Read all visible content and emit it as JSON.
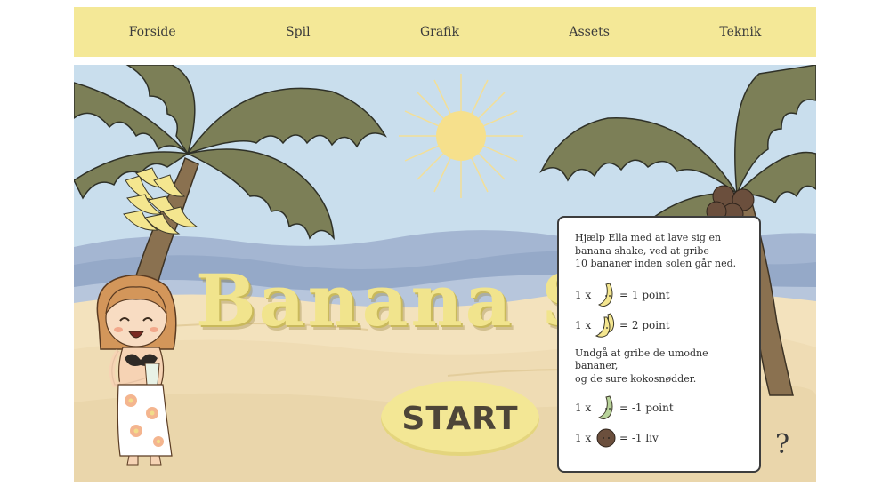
{
  "nav": {
    "items": [
      {
        "label": "Forside"
      },
      {
        "label": "Spil"
      },
      {
        "label": "Grafik"
      },
      {
        "label": "Assets"
      },
      {
        "label": "Teknik"
      }
    ]
  },
  "game": {
    "title": "Banana S",
    "start_label": "START",
    "help_label": "?"
  },
  "instructions": {
    "intro_lines": [
      "Hjælp Ella med at lave sig en",
      "banana shake, ved at gribe",
      "10 bananer inden solen går ned."
    ],
    "good_items": [
      {
        "qty": "1 x",
        "icon": "single-banana-icon",
        "value": "= 1 point"
      },
      {
        "qty": "1 x",
        "icon": "banana-bunch-icon",
        "value": "= 2 point"
      }
    ],
    "avoid_lines": [
      "Undgå at gribe de umodne bananer,",
      "og de sure kokosnødder."
    ],
    "bad_items": [
      {
        "qty": "1 x",
        "icon": "green-banana-icon",
        "value": "= -1 point"
      },
      {
        "qty": "1 x",
        "icon": "coconut-icon",
        "value": "= -1 liv"
      }
    ]
  },
  "colors": {
    "nav_background": "#f4e897",
    "sky": "#c9deed",
    "sea": "#9fb3cf",
    "sand": "#f3e2bd",
    "palm_leaf": "#7c7f57",
    "palm_trunk": "#8a7150",
    "sun": "#f5e08a",
    "title": "#f1e48d",
    "start_button": "#f3e795",
    "banana": "#f4e68f",
    "unripe_banana": "#b8d39a",
    "coconut": "#6b4f3d"
  }
}
